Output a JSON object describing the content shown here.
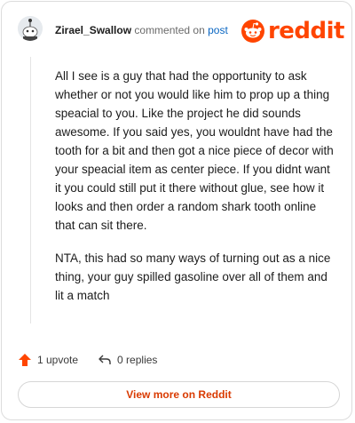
{
  "header": {
    "username": "Zirael_Swallow",
    "commented_text": "commented on",
    "post_link": "post",
    "brand": "reddit"
  },
  "comment": {
    "paragraphs": [
      "All I see is a guy that had the opportunity to ask whether or not you would like him to prop up a thing speacial to you. Like the project he did sounds awesome. If you said yes, you wouldnt have had the tooth for a bit and then got a nice piece of decor with your speacial item as center piece. If you didnt want it you could still put it there without glue, see how it looks and then order a random shark tooth online that can sit there.",
      "NTA, this had so many ways of turning out as a nice thing, your guy spilled gasoline over all of them and lit a match"
    ]
  },
  "actions": {
    "upvote_label": "1 upvote",
    "replies_label": "0 replies"
  },
  "footer": {
    "view_more": "View more on Reddit"
  },
  "colors": {
    "brand": "#ff4500",
    "link": "#0a66c2",
    "cta": "#d93a00"
  }
}
